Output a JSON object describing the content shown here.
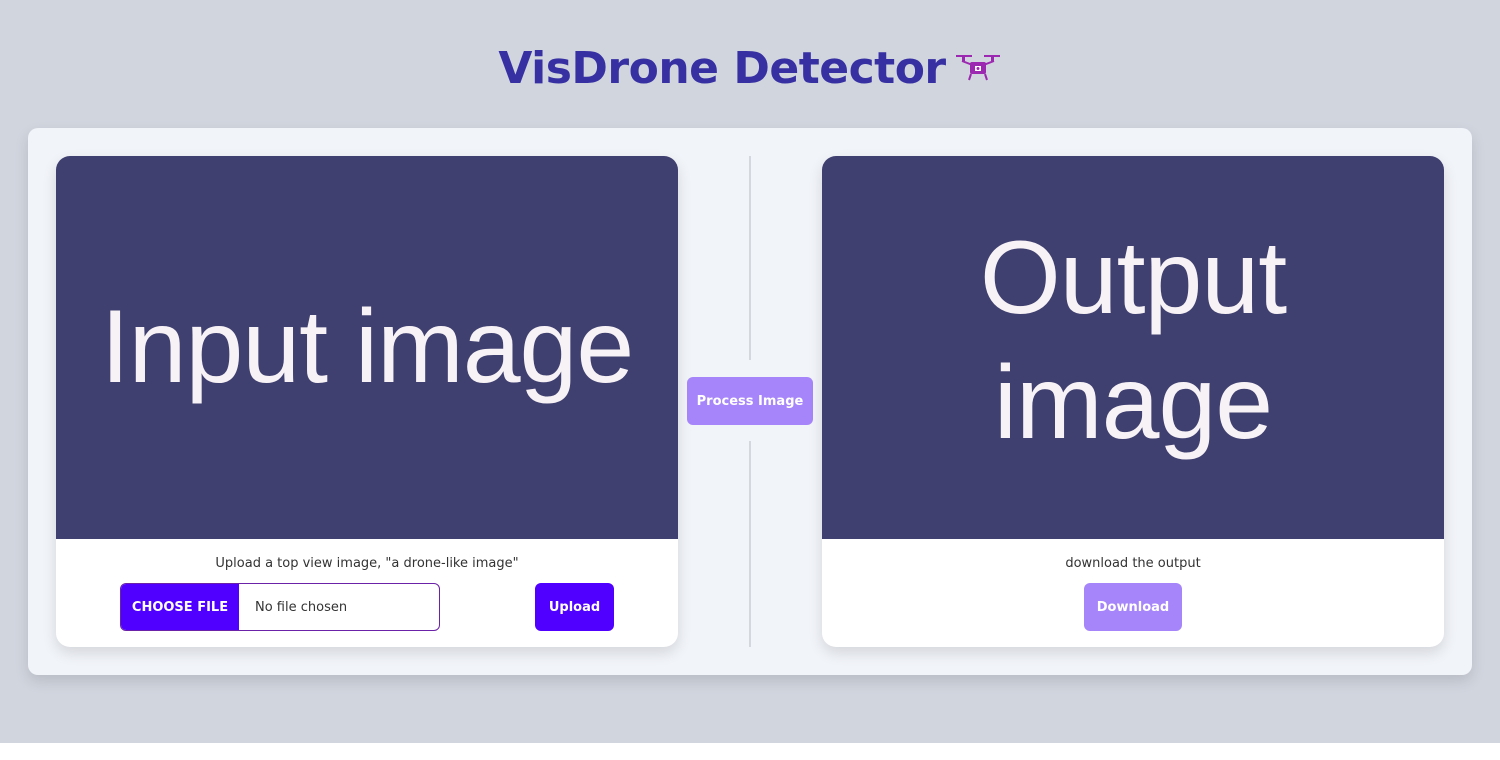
{
  "header": {
    "title": "VisDrone Detector",
    "icon": "drone-icon",
    "title_color": "#3730a3",
    "icon_color": "#9c27b0"
  },
  "input_card": {
    "placeholder_text": "Input image",
    "caption": "Upload a top view image, \"a drone-like image\"",
    "choose_file_label": "CHOOSE FILE",
    "file_status": "No file chosen",
    "upload_label": "Upload"
  },
  "process": {
    "label": "Process Image"
  },
  "output_card": {
    "placeholder_text": "Output image",
    "caption": "download the output",
    "download_label": "Download"
  },
  "colors": {
    "page_background": "#d1d5de",
    "panel_background": "#f1f4f9",
    "image_placeholder": "#3f3f70",
    "primary_button": "#4f00ff",
    "disabled_button": "#a685fa"
  }
}
